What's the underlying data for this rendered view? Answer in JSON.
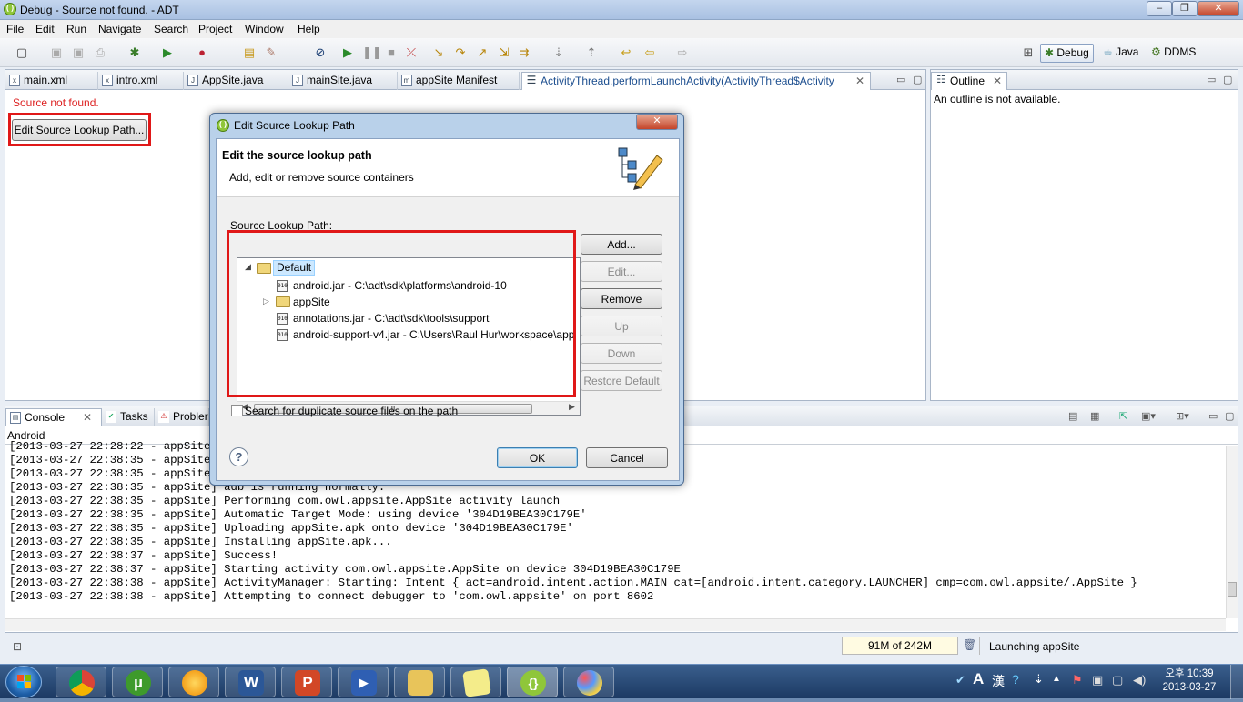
{
  "window": {
    "title": "Debug - Source not found. - ADT"
  },
  "menu": [
    "File",
    "Edit",
    "Run",
    "Navigate",
    "Search",
    "Project",
    "Window",
    "Help"
  ],
  "perspectives": {
    "debug": "Debug",
    "java": "Java",
    "ddms": "DDMS"
  },
  "editor": {
    "tabs": [
      "main.xml",
      "intro.xml",
      "AppSite.java",
      "mainSite.java",
      "appSite Manifest",
      "ActivityThread.performLaunchActivity(ActivityThread$Activity"
    ],
    "source_not_found": "Source not found.",
    "edit_lookup_button": "Edit Source Lookup Path..."
  },
  "outline": {
    "tab": "Outline",
    "message": "An outline is not available."
  },
  "console": {
    "tabs": [
      "Console",
      "Tasks",
      "Probler"
    ],
    "label": "Android",
    "lines": [
      "[2013-03-27 22:28:22 - appSite]",
      "[2013-03-27 22:38:35 - appSite]",
      "[2013-03-27 22:38:35 - appSite]",
      "[2013-03-27 22:38:35 - appSite] adb is running normally.",
      "[2013-03-27 22:38:35 - appSite] Performing com.owl.appsite.AppSite activity launch",
      "[2013-03-27 22:38:35 - appSite] Automatic Target Mode: using device '304D19BEA30C179E'",
      "[2013-03-27 22:38:35 - appSite] Uploading appSite.apk onto device '304D19BEA30C179E'",
      "[2013-03-27 22:38:35 - appSite] Installing appSite.apk...",
      "[2013-03-27 22:38:37 - appSite] Success!",
      "[2013-03-27 22:38:37 - appSite] Starting activity com.owl.appsite.AppSite on device 304D19BEA30C179E",
      "[2013-03-27 22:38:38 - appSite] ActivityManager: Starting: Intent { act=android.intent.action.MAIN cat=[android.intent.category.LAUNCHER] cmp=com.owl.appsite/.AppSite }",
      "[2013-03-27 22:38:38 - appSite] Attempting to connect debugger to 'com.owl.appsite' on port 8602"
    ]
  },
  "status": {
    "memory": "91M of 242M",
    "task": "Launching appSite"
  },
  "dialog": {
    "title": "Edit Source Lookup Path",
    "heading": "Edit the source lookup path",
    "subheading": "Add, edit or remove source containers",
    "path_label": "Source Lookup Path:",
    "tree": {
      "root": "Default",
      "items": [
        "android.jar - C:\\adt\\sdk\\platforms\\android-10",
        "appSite",
        "annotations.jar - C:\\adt\\sdk\\tools\\support",
        "android-support-v4.jar - C:\\Users\\Raul Hur\\workspace\\app"
      ]
    },
    "buttons": {
      "add": "Add...",
      "edit": "Edit...",
      "remove": "Remove",
      "up": "Up",
      "down": "Down",
      "restore": "Restore Default"
    },
    "checkbox": "Search for duplicate source files on the path",
    "ok": "OK",
    "cancel": "Cancel"
  },
  "taskbar": {
    "ime": "A",
    "hanja": "漢",
    "clock_time": "오후 10:39",
    "clock_date": "2013-03-27"
  }
}
